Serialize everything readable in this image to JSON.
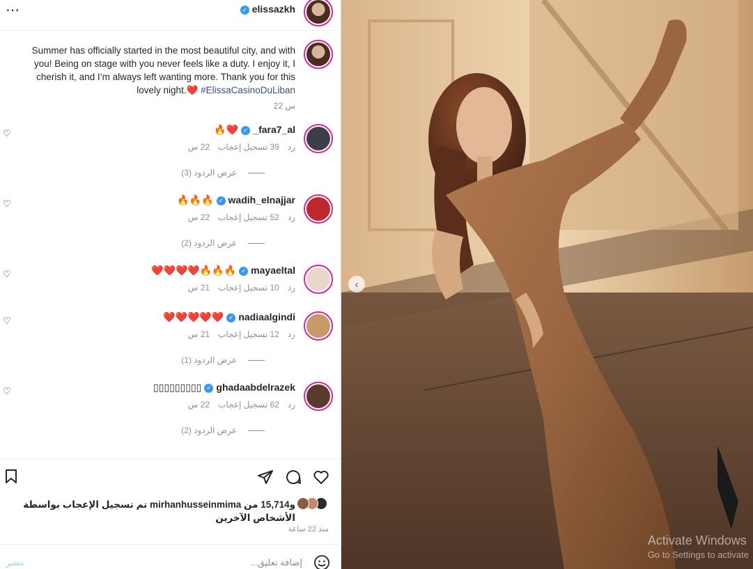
{
  "header": {
    "username": "elissazkh",
    "more_label": "⋯"
  },
  "caption": {
    "username": "elissazkh",
    "text": "Summer has officially started in the most beautiful city, and with you! Being on stage with you never feels like a duty. I enjoy it, I cherish it, and I’m always left wanting more. Thank you for this lovely night.❤️",
    "hashtag": "#ElissaCasinoDuLiban",
    "time": "22 س"
  },
  "comments": [
    {
      "username": "_fara7_al",
      "emoji": "🔥❤️",
      "time": "22 س",
      "likes": "39 تسجيل إعجاب",
      "reply": "رد",
      "replies": "عرض الردود (3)",
      "avatar_color": "#3b4048"
    },
    {
      "username": "wadih_elnajjar",
      "emoji": "🔥🔥🔥",
      "time": "22 س",
      "likes": "52 تسجيل إعجاب",
      "reply": "رد",
      "replies": "عرض الردود (2)",
      "avatar_color": "#c0272d"
    },
    {
      "username": "mayaeltal",
      "emoji": "❤️❤️❤️❤️🔥🔥🔥",
      "time": "21 س",
      "likes": "10 تسجيل إعجاب",
      "reply": "رد",
      "replies": "",
      "avatar_color": "#e9d7c9"
    },
    {
      "username": "nadiaalgindi",
      "emoji": "❤️❤️❤️❤️❤️",
      "time": "21 س",
      "likes": "12 تسجيل إعجاب",
      "reply": "رد",
      "replies": "عرض الردود (1)",
      "avatar_color": "#c89a6a"
    },
    {
      "username": "ghadaabdelrazek",
      "emoji": "▯▯▯▯▯▯▯▯▯",
      "time": "22 س",
      "likes": "62 تسجيل إعجاب",
      "reply": "رد",
      "replies": "عرض الردود (2)",
      "avatar_color": "#5a3a2a"
    }
  ],
  "actions": {
    "likes_text": "تم تسجيل الإعجاب بواسطة mirhanhusseinmima و15,714 من الأشخاص الآخرين",
    "post_time": "منذ 22 ساعة"
  },
  "add_comment": {
    "placeholder": "إضافة تعليق...",
    "post_label": "نشر"
  },
  "watermark": {
    "line1": "Activate Windows",
    "line2": "Go to Settings to activate"
  },
  "colors": {
    "accent": "#3897f0",
    "hashtag": "#385185",
    "post_button": "#b2dffc"
  }
}
